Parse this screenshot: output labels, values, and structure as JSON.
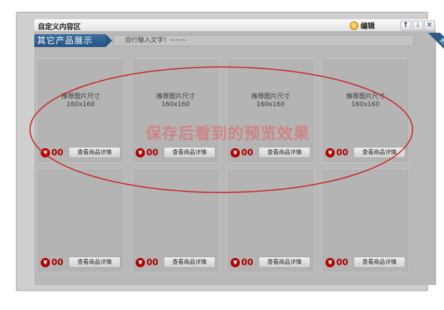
{
  "window": {
    "title": "自定义内容区",
    "edit_label": "编辑",
    "up_icon": "arrow-up-icon",
    "down_icon": "arrow-down-icon",
    "close_icon": "close-icon"
  },
  "header": {
    "section_title": "其它产品展示",
    "notice_text": "自行输入文字！~~~",
    "corner_label": "更多"
  },
  "overlay": {
    "preview_text": "保存后看到的预览效果",
    "ellipse_color": "#cc1f1f"
  },
  "products": [
    {
      "size_hint": "推荐图片尺寸",
      "size_value": "160x160",
      "price": "00",
      "detail_label": "查看商品详情"
    },
    {
      "size_hint": "推荐图片尺寸",
      "size_value": "160x160",
      "price": "00",
      "detail_label": "查看商品详情"
    },
    {
      "size_hint": "推荐图片尺寸",
      "size_value": "160x160",
      "price": "00",
      "detail_label": "查看商品详情"
    },
    {
      "size_hint": "推荐图片尺寸",
      "size_value": "160x160",
      "price": "00",
      "detail_label": "查看商品详情"
    },
    {
      "price": "00",
      "detail_label": "查看商品详情"
    },
    {
      "price": "00",
      "detail_label": "查看商品详情"
    },
    {
      "price": "00",
      "detail_label": "查看商品详情"
    },
    {
      "price": "00",
      "detail_label": "查看商品详情"
    }
  ],
  "currency_symbol": "¥"
}
